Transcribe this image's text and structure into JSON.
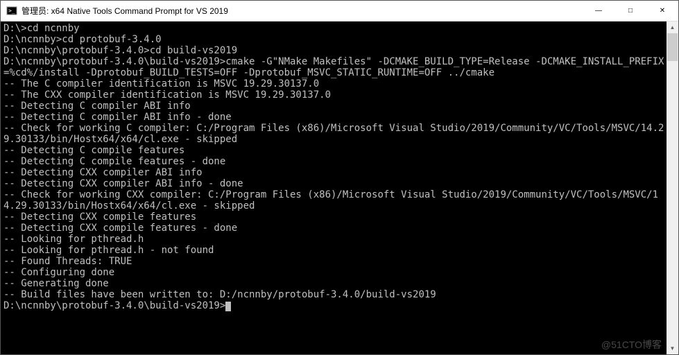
{
  "window": {
    "title": "管理员: x64 Native Tools Command Prompt for VS 2019",
    "controls": {
      "minimize": "—",
      "maximize": "□",
      "close": "✕"
    }
  },
  "terminal": {
    "lines": [
      "D:\\>cd ncnnby",
      "",
      "D:\\ncnnby>cd protobuf-3.4.0",
      "",
      "D:\\ncnnby\\protobuf-3.4.0>cd build-vs2019",
      "",
      "D:\\ncnnby\\protobuf-3.4.0\\build-vs2019>cmake -G\"NMake Makefiles\" -DCMAKE_BUILD_TYPE=Release -DCMAKE_INSTALL_PREFIX=%cd%/install -Dprotobuf_BUILD_TESTS=OFF -Dprotobuf_MSVC_STATIC_RUNTIME=OFF ../cmake",
      "-- The C compiler identification is MSVC 19.29.30137.0",
      "-- The CXX compiler identification is MSVC 19.29.30137.0",
      "-- Detecting C compiler ABI info",
      "-- Detecting C compiler ABI info - done",
      "-- Check for working C compiler: C:/Program Files (x86)/Microsoft Visual Studio/2019/Community/VC/Tools/MSVC/14.29.30133/bin/Hostx64/x64/cl.exe - skipped",
      "-- Detecting C compile features",
      "-- Detecting C compile features - done",
      "-- Detecting CXX compiler ABI info",
      "-- Detecting CXX compiler ABI info - done",
      "-- Check for working CXX compiler: C:/Program Files (x86)/Microsoft Visual Studio/2019/Community/VC/Tools/MSVC/14.29.30133/bin/Hostx64/x64/cl.exe - skipped",
      "-- Detecting CXX compile features",
      "-- Detecting CXX compile features - done",
      "-- Looking for pthread.h",
      "-- Looking for pthread.h - not found",
      "-- Found Threads: TRUE",
      "-- Configuring done",
      "-- Generating done",
      "-- Build files have been written to: D:/ncnnby/protobuf-3.4.0/build-vs2019",
      "",
      "D:\\ncnnby\\protobuf-3.4.0\\build-vs2019>"
    ]
  },
  "scrollbar": {
    "up": "▲",
    "down": "▼"
  },
  "watermark": "@51CTO博客"
}
